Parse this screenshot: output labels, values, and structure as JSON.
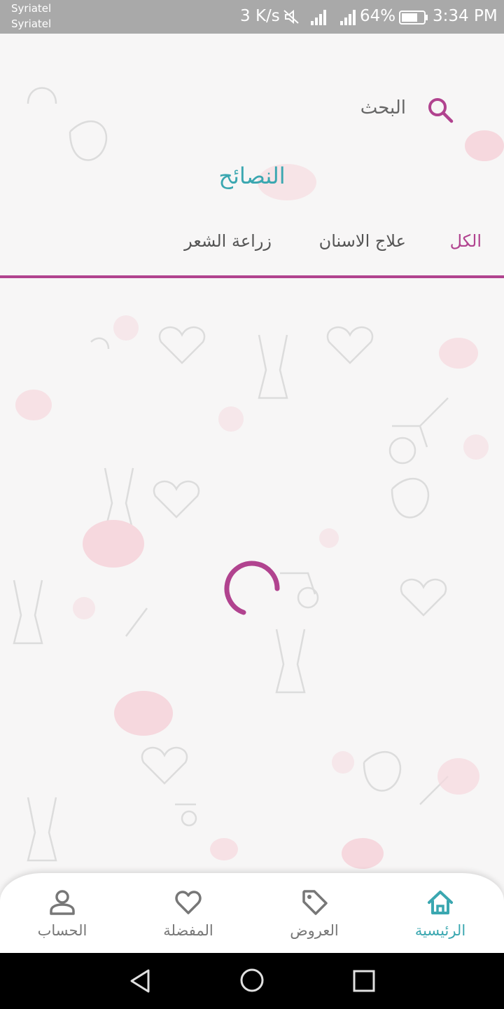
{
  "status_bar": {
    "carrier_1": "Syriatel",
    "carrier_2": "Syriatel",
    "net_speed": "3 K/s",
    "battery": "64%",
    "time": "3:34 PM"
  },
  "search": {
    "label": "البحث",
    "icon": "search-icon"
  },
  "page": {
    "title": "النصائح"
  },
  "tabs": [
    {
      "label": "الكل",
      "active": true
    },
    {
      "label": "علاج الاسنان",
      "active": false
    },
    {
      "label": "زراعة الشعر",
      "active": false
    }
  ],
  "bottom_nav": [
    {
      "label": "الرئيسية",
      "icon": "home-icon",
      "active": true
    },
    {
      "label": "العروض",
      "icon": "tag-icon",
      "active": false
    },
    {
      "label": "المفضلة",
      "icon": "heart-icon",
      "active": false
    },
    {
      "label": "الحساب",
      "icon": "user-icon",
      "active": false
    }
  ],
  "colors": {
    "accent_purple": "#b1438f",
    "accent_teal": "#3aa7b0",
    "status_bar": "#a9a9a9"
  }
}
